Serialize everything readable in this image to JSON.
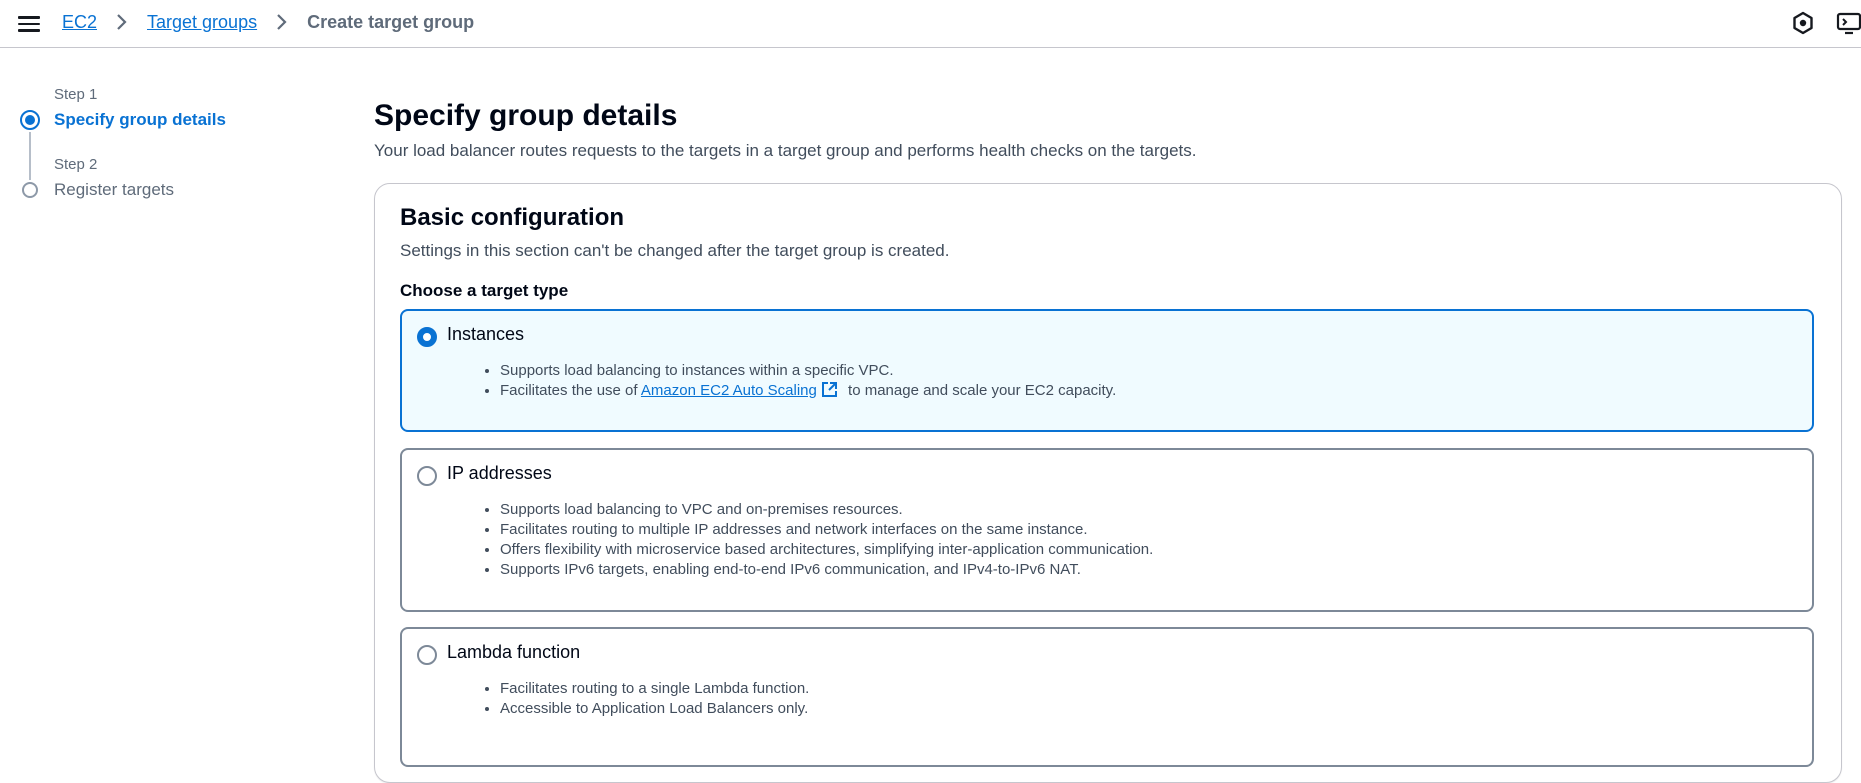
{
  "breadcrumb": {
    "ec2": "EC2",
    "target_groups": "Target groups",
    "current": "Create target group"
  },
  "wizard": {
    "steps": [
      {
        "label": "Step 1",
        "title": "Specify group details",
        "state": "active"
      },
      {
        "label": "Step 2",
        "title": "Register targets",
        "state": "inactive"
      }
    ]
  },
  "page": {
    "title": "Specify group details",
    "description": "Your load balancer routes requests to the targets in a target group and performs health checks on the targets."
  },
  "basic_config": {
    "title": "Basic configuration",
    "description": "Settings in this section can't be changed after the target group is created.",
    "target_type_label": "Choose a target type",
    "options": [
      {
        "title": "Instances",
        "selected": true,
        "bullets": [
          "Supports load balancing to instances within a specific VPC."
        ],
        "bullet2_prefix": "Facilitates the use of ",
        "bullet2_link": "Amazon EC2 Auto Scaling",
        "bullet2_suffix": " to manage and scale your EC2 capacity."
      },
      {
        "title": "IP addresses",
        "selected": false,
        "bullets": [
          "Supports load balancing to VPC and on-premises resources.",
          "Facilitates routing to multiple IP addresses and network interfaces on the same instance.",
          "Offers flexibility with microservice based architectures, simplifying inter-application communication.",
          "Supports IPv6 targets, enabling end-to-end IPv6 communication, and IPv4-to-IPv6 NAT."
        ]
      },
      {
        "title": "Lambda function",
        "selected": false,
        "bullets": [
          "Facilitates routing to a single Lambda function.",
          "Accessible to Application Load Balancers only."
        ]
      }
    ]
  },
  "colors": {
    "accent": "#0972d3",
    "selected_bg": "#f0fbff",
    "border": "#7d8998",
    "text_secondary": "#5f6b7a"
  },
  "icons": {
    "menu": "hamburger-menu-icon",
    "crumb_separator": "chevron-right-icon",
    "settings": "settings-hexagon-icon",
    "cloudshell": "cloudshell-icon",
    "external": "external-link-icon"
  }
}
